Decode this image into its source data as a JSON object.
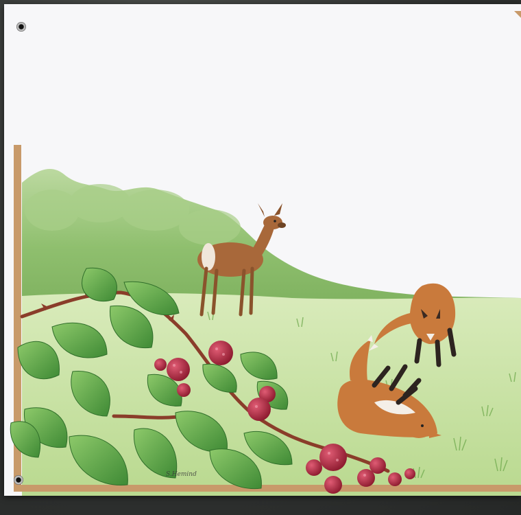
{
  "scene": {
    "description_icons": [
      "deer-icon",
      "fox-kit-icon",
      "blackberry-icon",
      "leaf-icon",
      "grommet-icon"
    ],
    "colors": {
      "paper": "#ffffff",
      "sky": "#f6f6f8",
      "hills": "#8fbf6e",
      "meadow": "#c8e0a2",
      "border_wood": "#c89a6a",
      "fox": "#c97a3c",
      "deer": "#a8683a",
      "berry": "#b5243e",
      "leaf": "#5fa84a"
    }
  }
}
